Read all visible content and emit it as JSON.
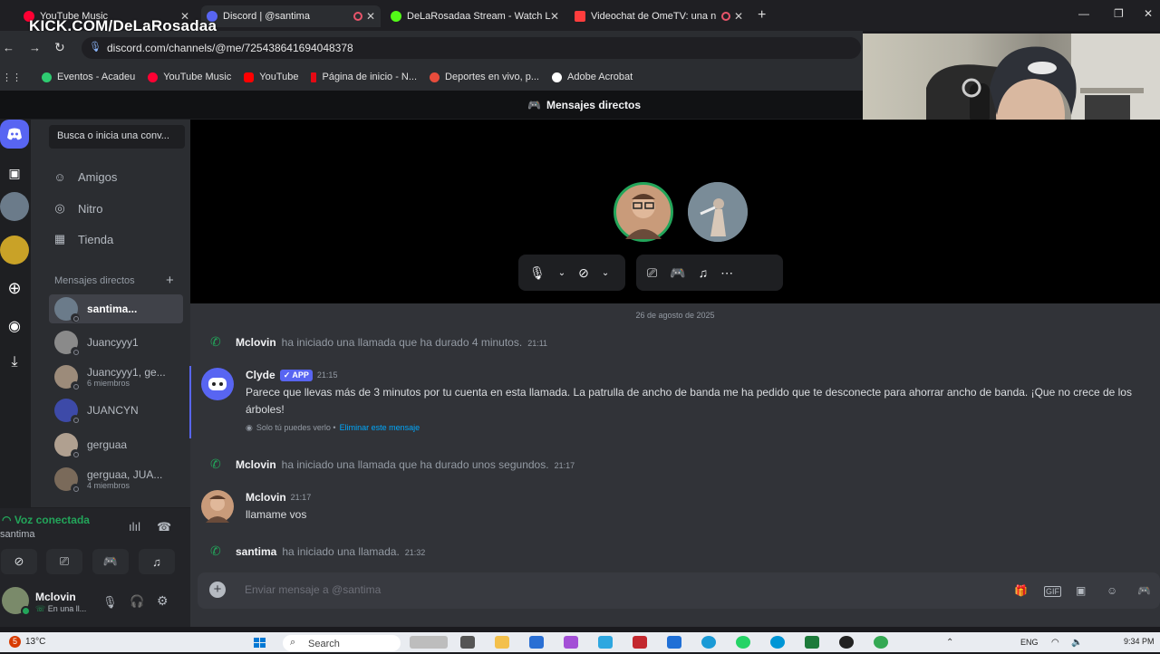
{
  "overlay": {
    "kick_text": "KICK.COM/DeLaRosadaa"
  },
  "tabs": [
    {
      "title": "YouTube Music",
      "color": "#ff0033"
    },
    {
      "title": "Discord | @santima",
      "color": "#5865f2"
    },
    {
      "title": "DeLaRosadaa Stream - Watch L",
      "color": "#53fc18"
    },
    {
      "title": "Videochat de OmeTV: una n",
      "color": "#ff3d3d"
    }
  ],
  "address": {
    "url": "discord.com/channels/@me/725438641694048378"
  },
  "bookmarks": [
    {
      "label": "Eventos - Acadeu",
      "color": "#2ecc71"
    },
    {
      "label": "YouTube Music",
      "color": "#ff0033"
    },
    {
      "label": "YouTube",
      "color": "#ff0000"
    },
    {
      "label": "Página de inicio - N...",
      "color": "#e50914"
    },
    {
      "label": "Deportes en vivo, p...",
      "color": "#e74c3c"
    },
    {
      "label": "Adobe Acrobat",
      "color": "#ffffff"
    }
  ],
  "discord": {
    "topbar_title": "Mensajes directos",
    "search_placeholder": "Busca o inicia una conv...",
    "nav": [
      {
        "label": "Amigos",
        "icon": "friends-icon",
        "glyph": "☺"
      },
      {
        "label": "Nitro",
        "icon": "nitro-icon",
        "glyph": "◎"
      },
      {
        "label": "Tienda",
        "icon": "store-icon",
        "glyph": "▦"
      }
    ],
    "dm_header": "Mensajes directos",
    "dms": [
      {
        "name": "santima...",
        "sub": "",
        "color": "#6b7b8a"
      },
      {
        "name": "Juancyyy1",
        "sub": "",
        "color": "#8a8a8a"
      },
      {
        "name": "Juancyyy1, ge...",
        "sub": "6 miembros",
        "color": "#9c8b7a"
      },
      {
        "name": "JUANCYN",
        "sub": "",
        "color": "#3d4aa8"
      },
      {
        "name": "gerguaa",
        "sub": "",
        "color": "#b0a090"
      },
      {
        "name": "gerguaa, JUA...",
        "sub": "4 miembros",
        "color": "#7a6a5a"
      }
    ],
    "voice": {
      "status": "Voz conectada",
      "channel": "santima"
    },
    "user": {
      "name": "Mclovin",
      "status": "En una ll..."
    },
    "date_divider": "26 de agosto de 2025",
    "messages": [
      {
        "type": "system",
        "author": "Mclovin",
        "text": "ha iniciado una llamada que ha durado 4 minutos.",
        "time": "21:11"
      },
      {
        "type": "message",
        "author": "Clyde",
        "badge": "APP",
        "time": "21:15",
        "text": "Parece que llevas más de 3 minutos por tu cuenta en esta llamada. La patrulla de ancho de banda me ha pedido que te desconecte para ahorrar ancho de banda. ¡Que no crece de los árboles!",
        "ephemeral": "Solo tú puedes verlo •",
        "ephemeral_link": "Eliminar este mensaje"
      },
      {
        "type": "system",
        "author": "Mclovin",
        "text": "ha iniciado una llamada que ha durado unos segundos.",
        "time": "21:17"
      },
      {
        "type": "message",
        "author": "Mclovin",
        "time": "21:17",
        "text": "llamame vos"
      },
      {
        "type": "system",
        "author": "santima",
        "text": "ha iniciado una llamada.",
        "time": "21:32"
      }
    ],
    "composer_placeholder": "Enviar mensaje a @santima"
  },
  "taskbar": {
    "weather_temp": "13°C",
    "notif_count": "5",
    "search_label": "Search",
    "lang": "ENG",
    "time": "9:34 PM"
  },
  "colors": {
    "accent": "#5865f2",
    "online": "#23a55a",
    "danger": "#da373c"
  }
}
